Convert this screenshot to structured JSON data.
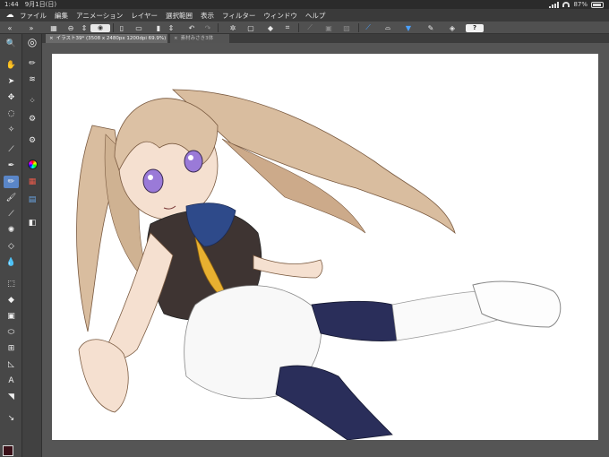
{
  "status": {
    "time": "1:44",
    "date": "9月1日(日)",
    "battery": "87%",
    "battery_level": 0.87
  },
  "app_logo": "☁",
  "menu": {
    "items": [
      "ファイル",
      "編集",
      "アニメーション",
      "レイヤー",
      "選択範囲",
      "表示",
      "フィルター",
      "ウィンドウ",
      "ヘルプ"
    ]
  },
  "toolbar": {
    "help_label": "?"
  },
  "documents": {
    "active": "イラスト39* (3508 x 2480px 1200dpi 69.9%)",
    "inactive": "素材みさき3体"
  },
  "colors": {
    "main": "#3a1018",
    "sub": "#ffffff",
    "accent": "#5a86c8",
    "canvas": "#ffffff"
  },
  "canvas_content": "anime-girl-illustration"
}
